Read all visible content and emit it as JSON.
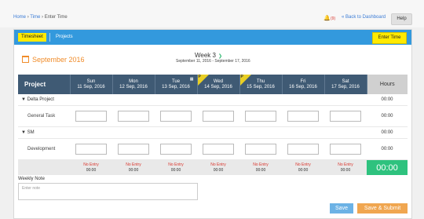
{
  "breadcrumb": {
    "home": "Home",
    "sep1": "›",
    "time": "Time",
    "sep2": "›",
    "current": "Enter Time"
  },
  "alerts": {
    "icon": "bell-icon",
    "count": "(9)"
  },
  "back_link": "« Back to Dashboard",
  "help_label": "Help",
  "tabs": {
    "timesheet": "Timesheet",
    "projects": "Projects"
  },
  "enter_time_label": "Enter Time",
  "month_label": "September 2016",
  "week": {
    "label": "Week 3",
    "range": "September 11, 2016 - September 17, 2016"
  },
  "table": {
    "project_header": "Project",
    "hours_header": "Hours",
    "days": [
      {
        "name": "Sun",
        "date": "11 Sep, 2016",
        "flag": ""
      },
      {
        "name": "Mon",
        "date": "12 Sep, 2016",
        "flag": ""
      },
      {
        "name": "Tue",
        "date": "13 Sep, 2016",
        "flag": ""
      },
      {
        "name": "Wed",
        "date": "14 Sep, 2016",
        "flag": "P"
      },
      {
        "name": "Thu",
        "date": "15 Sep, 2016",
        "flag": "P"
      },
      {
        "name": "Fri",
        "date": "16 Sep, 2016",
        "flag": ""
      },
      {
        "name": "Sat",
        "date": "17 Sep, 2016",
        "flag": ""
      }
    ],
    "groups": [
      {
        "name": "Delta Project",
        "hours": "00:00",
        "task": "General Task",
        "task_hours": "00:00"
      },
      {
        "name": "SM",
        "hours": "00:00",
        "task": "Development",
        "task_hours": "00:00"
      }
    ],
    "totals": {
      "status": [
        "No Entry",
        "No Entry",
        "No Entry",
        "No Entry",
        "No Entry",
        "No Entry",
        "No Entry"
      ],
      "values": [
        "00:00",
        "00:00",
        "00:00",
        "00:00",
        "00:00",
        "00:00",
        "00:00"
      ],
      "grand_total": "00:00"
    }
  },
  "weekly_note": {
    "label": "Weekly Note",
    "placeholder": "Enter note"
  },
  "buttons": {
    "save": "Save",
    "save_submit": "Save & Submit"
  },
  "colors": {
    "accent": "#3399dd",
    "highlight": "#ffea00",
    "header": "#3f5a74",
    "total": "#2ec27e",
    "save": "#6cb2e5",
    "save_submit": "#f0a650",
    "no_entry": "#d9342b"
  }
}
